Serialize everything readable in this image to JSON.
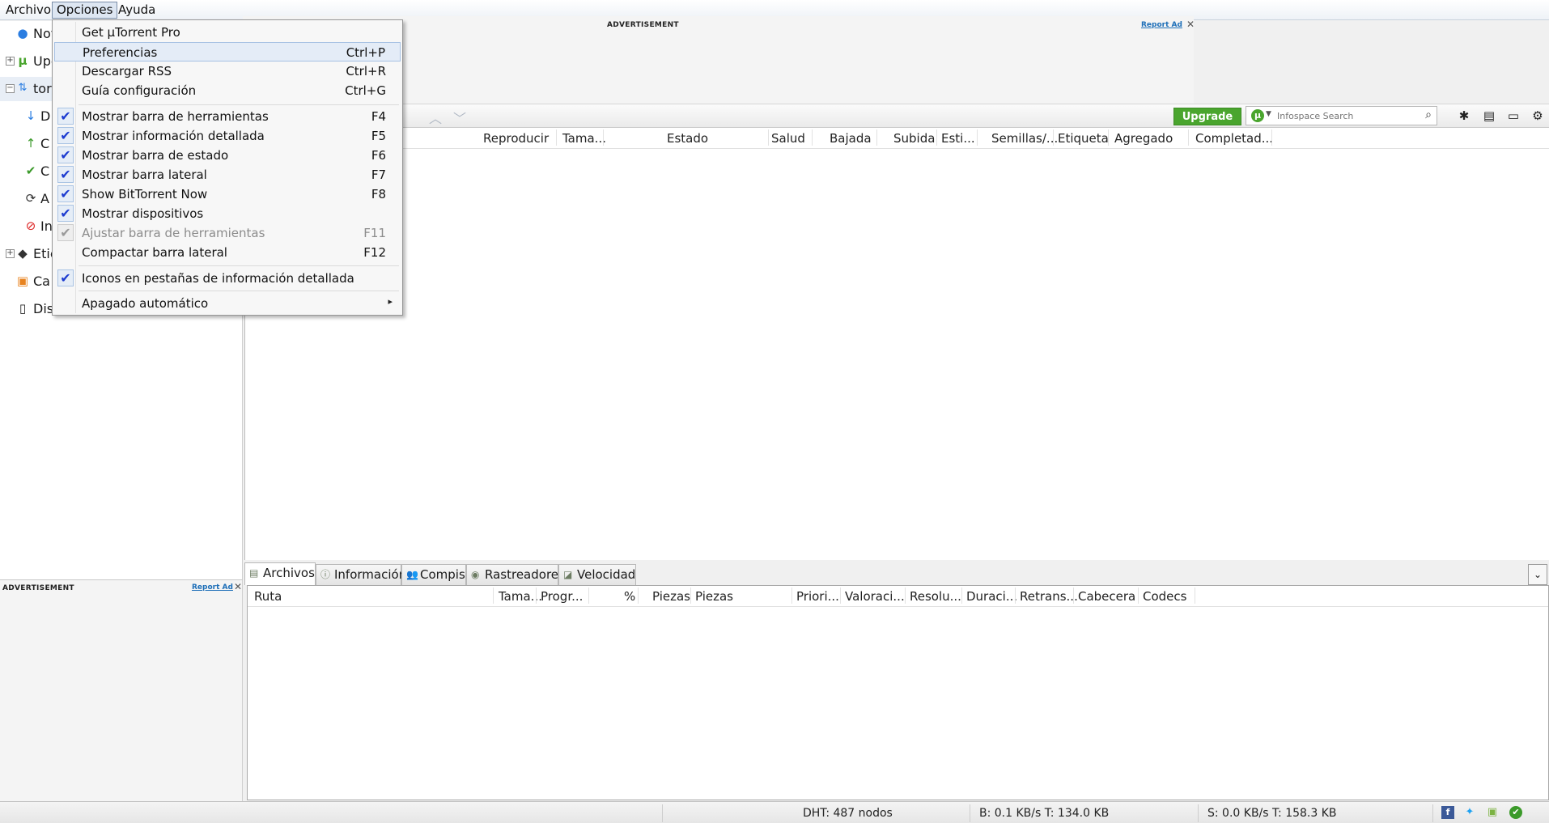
{
  "menubar": {
    "items": [
      "Archivo",
      "Opciones",
      "Ayuda"
    ]
  },
  "sidebar": {
    "items": [
      {
        "label": "Nov",
        "icon": "feed-icon"
      },
      {
        "label": "Upg",
        "icon": "utorrent-logo-icon"
      },
      {
        "label": "tor",
        "icon": "torrents-icon"
      },
      {
        "label": "D",
        "icon": "download-arrow-icon"
      },
      {
        "label": "C",
        "icon": "upload-arrow-icon"
      },
      {
        "label": "C",
        "icon": "checkmark-icon"
      },
      {
        "label": "A",
        "icon": "refresh-icon"
      },
      {
        "label": "In",
        "icon": "inactive-icon"
      },
      {
        "label": "Etic",
        "icon": "tag-icon"
      },
      {
        "label": "Ca",
        "icon": "rss-icon"
      },
      {
        "label": "Dis",
        "icon": "device-icon"
      }
    ]
  },
  "ads": {
    "label": "ADVERTISEMENT",
    "report": "Report Ad",
    "close": "✕"
  },
  "toolbar": {
    "upgrade_label": "Upgrade",
    "search_placeholder": "Infospace Search"
  },
  "torrent_list": {
    "columns": [
      "Reproducir",
      "Tama...",
      "Estado",
      "Salud",
      "Bajada",
      "Subida",
      "Esti...",
      "Semillas/...",
      "Etiqueta",
      "Agregado",
      "Completad..."
    ]
  },
  "bottom_tabs": [
    "Archivos",
    "Información",
    "Compis",
    "Rastreadores",
    "Velocidad"
  ],
  "files_list": {
    "columns": [
      "Ruta",
      "Tama...",
      "Progr...",
      "%",
      "Piezas",
      "Piezas",
      "Priori...",
      "Valoraci...",
      "Resolu...",
      "Duraci...",
      "Retrans...",
      "Cabecera",
      "Codecs"
    ]
  },
  "statusbar": {
    "dht": "DHT: 487 nodos",
    "download": "B: 0.1 KB/s T: 134.0 KB",
    "upload": "S: 0.0 KB/s T: 158.3 KB"
  },
  "options_menu": {
    "group1": [
      {
        "label": "Get µTorrent Pro",
        "shortcut": ""
      },
      {
        "label": "Preferencias",
        "shortcut": "Ctrl+P"
      },
      {
        "label": "Descargar RSS",
        "shortcut": "Ctrl+R"
      },
      {
        "label": "Guía configuración",
        "shortcut": "Ctrl+G"
      }
    ],
    "group2": [
      {
        "label": "Mostrar barra de herramientas",
        "shortcut": "F4",
        "checked": true
      },
      {
        "label": "Mostrar información detallada",
        "shortcut": "F5",
        "checked": true
      },
      {
        "label": "Mostrar barra de estado",
        "shortcut": "F6",
        "checked": true
      },
      {
        "label": "Mostrar barra lateral",
        "shortcut": "F7",
        "checked": true
      },
      {
        "label": "Show BitTorrent Now",
        "shortcut": "F8",
        "checked": true
      },
      {
        "label": "Mostrar dispositivos",
        "shortcut": "",
        "checked": true
      },
      {
        "label": "Ajustar barra de herramientas",
        "shortcut": "F11",
        "checked": true,
        "disabled": true
      },
      {
        "label": "Compactar barra lateral",
        "shortcut": "F12",
        "checked": false
      }
    ],
    "group3": [
      {
        "label": "Iconos en pestañas de información detallada",
        "shortcut": "",
        "checked": true
      }
    ],
    "group4": [
      {
        "label": "Apagado automático",
        "submenu": true
      }
    ],
    "check_glyph": "✔",
    "submenu_glyph": "▸"
  }
}
